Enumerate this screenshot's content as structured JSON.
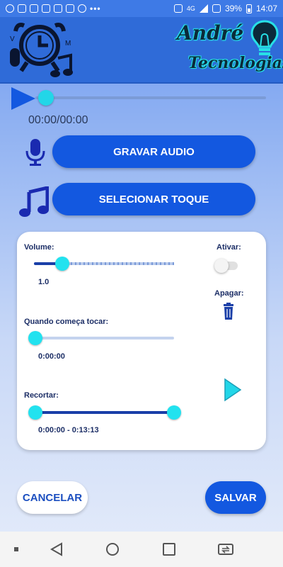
{
  "status_bar": {
    "battery": "39%",
    "time": "14:07",
    "network": "4G",
    "dots": "•••"
  },
  "header": {
    "brand_line1": "André",
    "brand_line2": "Tecnologias"
  },
  "player": {
    "time": "00:00/00:00",
    "progress": 0
  },
  "buttons": {
    "record": "GRAVAR AUDIO",
    "select_ringtone": "SELECIONAR TOQUE",
    "cancel": "CANCELAR",
    "save": "SALVAR"
  },
  "settings": {
    "volume_label": "Volume:",
    "volume_value": "1.0",
    "activate_label": "Ativar:",
    "activate_on": false,
    "delete_label": "Apagar:",
    "start_label": "Quando começa tocar:",
    "start_value": "0:00:00",
    "trim_label": "Recortar:",
    "trim_value": "0:00:00 - 0:13:13"
  },
  "colors": {
    "accent": "#1358e0",
    "thumb": "#22e2ef",
    "header": "#2f6bd8"
  },
  "icons": [
    "whatsapp-icon",
    "instagram-icon",
    "image-icon",
    "mic-icon",
    "music-note-icon",
    "trash-icon",
    "play-icon",
    "lightbulb-icon",
    "alarm-clock-icon"
  ]
}
